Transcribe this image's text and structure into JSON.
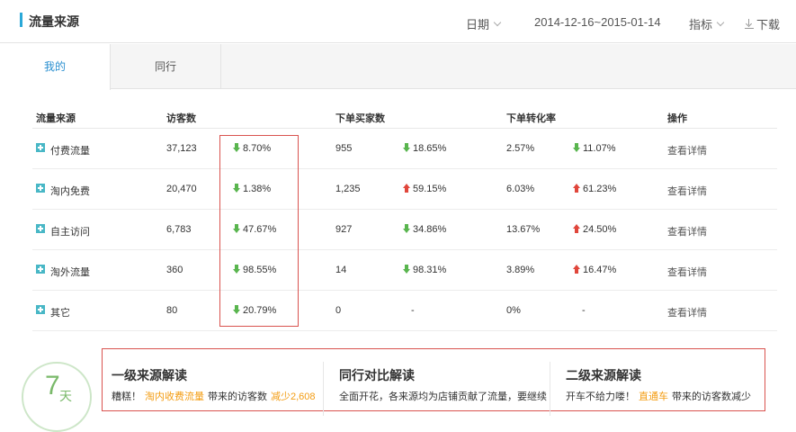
{
  "header": {
    "title": "流量来源",
    "date_label": "日期",
    "date_range": "2014-12-16~2015-01-14",
    "metric_label": "指标",
    "download_label": "下载"
  },
  "tabs": [
    {
      "label": "我的",
      "active": true
    },
    {
      "label": "同行",
      "active": false
    }
  ],
  "table": {
    "headers": {
      "source": "流量来源",
      "visitors": "访客数",
      "buyers": "下单买家数",
      "conversion": "下单转化率",
      "action": "操作"
    },
    "rows": [
      {
        "source": "付费流量",
        "visitors": "37,123",
        "visitors_change": "8.70%",
        "visitors_dir": "down",
        "buyers": "955",
        "buyers_change": "18.65%",
        "buyers_dir": "down",
        "conversion": "2.57%",
        "conversion_change": "11.07%",
        "conversion_dir": "down",
        "action": "查看详情"
      },
      {
        "source": "淘内免费",
        "visitors": "20,470",
        "visitors_change": "1.38%",
        "visitors_dir": "down",
        "buyers": "1,235",
        "buyers_change": "59.15%",
        "buyers_dir": "up",
        "conversion": "6.03%",
        "conversion_change": "61.23%",
        "conversion_dir": "up",
        "action": "查看详情"
      },
      {
        "source": "自主访问",
        "visitors": "6,783",
        "visitors_change": "47.67%",
        "visitors_dir": "down",
        "buyers": "927",
        "buyers_change": "34.86%",
        "buyers_dir": "down",
        "conversion": "13.67%",
        "conversion_change": "24.50%",
        "conversion_dir": "up",
        "action": "查看详情"
      },
      {
        "source": "淘外流量",
        "visitors": "360",
        "visitors_change": "98.55%",
        "visitors_dir": "down",
        "buyers": "14",
        "buyers_change": "98.31%",
        "buyers_dir": "down",
        "conversion": "3.89%",
        "conversion_change": "16.47%",
        "conversion_dir": "up",
        "action": "查看详情"
      },
      {
        "source": "其它",
        "visitors": "80",
        "visitors_change": "20.79%",
        "visitors_dir": "down",
        "buyers": "0",
        "buyers_change": "-",
        "buyers_dir": "none",
        "conversion": "0%",
        "conversion_change": "-",
        "conversion_dir": "none",
        "action": "查看详情"
      }
    ]
  },
  "period": {
    "number": "7",
    "unit": "天"
  },
  "insights": [
    {
      "title": "一级来源解读",
      "text_parts": [
        {
          "text": "糟糕！",
          "highlight": false
        },
        {
          "text": "淘内收费流量",
          "highlight": true
        },
        {
          "text": "带来的访客数",
          "highlight": false
        },
        {
          "text": "减少2,608",
          "highlight": true
        }
      ]
    },
    {
      "title": "同行对比解读",
      "text_parts": [
        {
          "text": "全面开花，各来源均为店铺贡献了流量，要继续",
          "highlight": false
        }
      ]
    },
    {
      "title": "二级来源解读",
      "text_parts": [
        {
          "text": "开车不给力喽！",
          "highlight": false
        },
        {
          "text": "直通车",
          "highlight": true
        },
        {
          "text": "带来的访客数减少",
          "highlight": false
        }
      ]
    }
  ],
  "colors": {
    "accent": "#2aa8d8",
    "tab_active": "#2a8fd0",
    "down": "#59b54e",
    "up": "#e0463b",
    "highlight": "#f39c12",
    "annotation_box": "#d9534f"
  }
}
